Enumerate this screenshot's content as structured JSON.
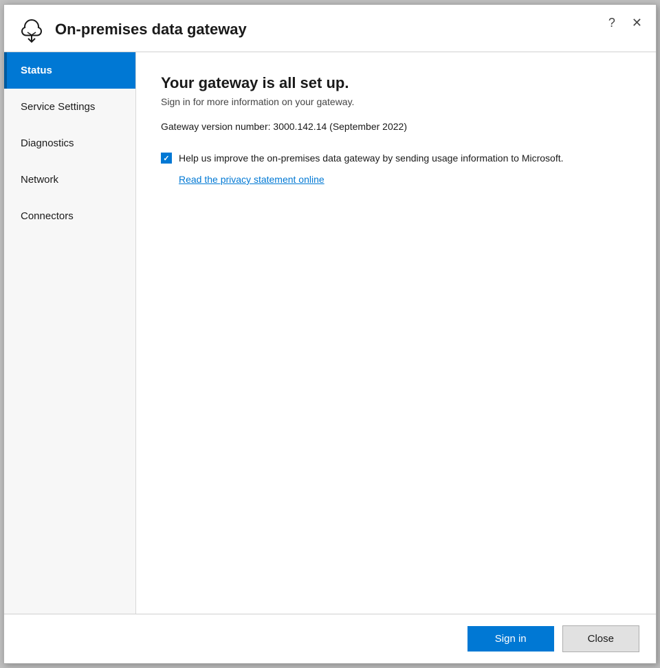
{
  "window": {
    "title": "On-premises data gateway"
  },
  "titlebar": {
    "help_label": "?",
    "close_label": "✕"
  },
  "sidebar": {
    "items": [
      {
        "id": "status",
        "label": "Status",
        "active": true
      },
      {
        "id": "service-settings",
        "label": "Service Settings",
        "active": false
      },
      {
        "id": "diagnostics",
        "label": "Diagnostics",
        "active": false
      },
      {
        "id": "network",
        "label": "Network",
        "active": false
      },
      {
        "id": "connectors",
        "label": "Connectors",
        "active": false
      }
    ]
  },
  "content": {
    "title": "Your gateway is all set up.",
    "subtitle": "Sign in for more information on your gateway.",
    "version_text": "Gateway version number: 3000.142.14 (September 2022)",
    "checkbox_text": "Help us improve the on-premises data gateway by sending usage information to Microsoft.",
    "privacy_link": "Read the privacy statement online"
  },
  "footer": {
    "signin_label": "Sign in",
    "close_label": "Close"
  }
}
